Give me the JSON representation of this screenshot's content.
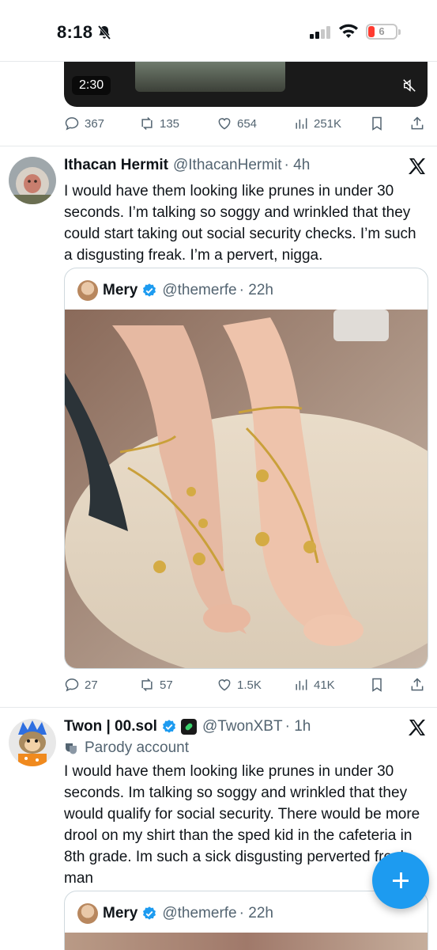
{
  "status_bar": {
    "time": "8:18",
    "battery": "6"
  },
  "video": {
    "duration": "2:30"
  },
  "tweet0": {
    "replies": "367",
    "reposts": "135",
    "likes": "654",
    "views": "251K"
  },
  "tweet1": {
    "name": "Ithacan Hermit",
    "handle": "@IthacanHermit",
    "time": "· 4h",
    "text": "I would have them looking like prunes in under 30 seconds. I’m talking so soggy and wrinkled that they could start taking out social security checks. I’m such a disgusting freak. I’m a pervert, nigga.",
    "quote": {
      "name": "Mery",
      "handle": "@themerfe",
      "time": "· 22h"
    },
    "replies": "27",
    "reposts": "57",
    "likes": "1.5K",
    "views": "41K"
  },
  "tweet2": {
    "name": "Twon | 00.sol",
    "handle": "@TwonXBT",
    "time": "· 1h",
    "label": "Parody account",
    "text": "I would have them looking like prunes in under 30 seconds. Im talking so soggy and wrinkled that they would qualify for social security. There would be more drool on my shirt than the sped kid in the cafeteria in 8th grade. Im such a sick disgusting perverted freak man",
    "quote": {
      "name": "Mery",
      "handle": "@themerfe",
      "time": "· 22h"
    }
  },
  "colors": {
    "accent": "#1d9bf0",
    "muted": "#536471",
    "verified": "#1d9bf0"
  },
  "icons": [
    "bell-off-icon",
    "signal-icon",
    "wifi-icon",
    "battery-icon",
    "mute-icon",
    "reply-icon",
    "repost-icon",
    "like-icon",
    "views-icon",
    "bookmark-icon",
    "share-icon",
    "x-logo-icon",
    "verified-icon",
    "theater-mask-icon",
    "plus-icon"
  ]
}
